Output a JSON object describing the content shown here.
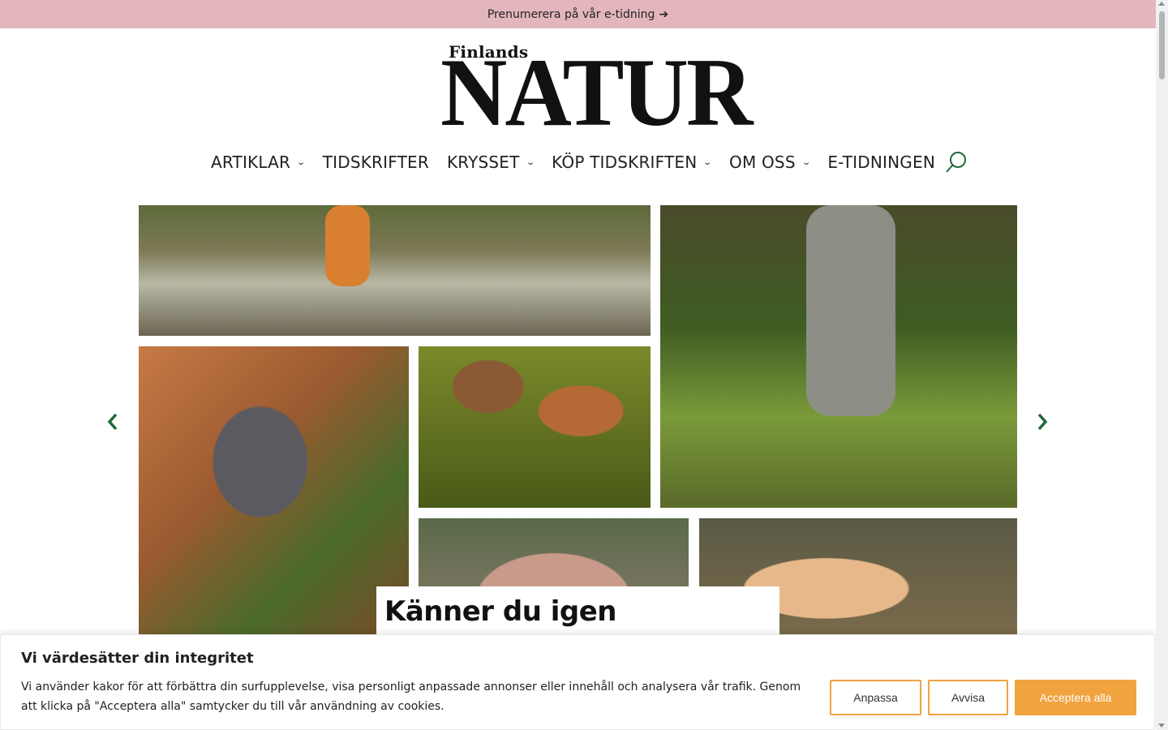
{
  "topbar": {
    "text": "Prenumerera på vår e-tidning",
    "arrow": "➔"
  },
  "logo": {
    "small": "Finlands",
    "big": "NATUR"
  },
  "nav": {
    "items": [
      {
        "label": "ARTIKLAR",
        "has_dropdown": true
      },
      {
        "label": "TIDSKRIFTER",
        "has_dropdown": false
      },
      {
        "label": "KRYSSET",
        "has_dropdown": true
      },
      {
        "label": "KÖP TIDSKRIFTEN",
        "has_dropdown": true
      },
      {
        "label": "OM OSS",
        "has_dropdown": true
      },
      {
        "label": "E-TIDNINGEN",
        "has_dropdown": false
      }
    ],
    "chevron": "⌄",
    "search_icon": "search-icon",
    "accent_color": "#1e6b3a"
  },
  "slider": {
    "title": "Känner du igen svamparna?",
    "prev_icon": "chevron-left-icon",
    "next_icon": "chevron-right-icon"
  },
  "cookie": {
    "title": "Vi värdesätter din integritet",
    "text": "Vi använder kakor för att förbättra din surfupplevelse, visa personligt anpassade annonser eller innehåll och analysera vår trafik. Genom att klicka på \"Acceptera alla\" samtycker du till vår användning av cookies.",
    "btn_customize": "Anpassa",
    "btn_reject": "Avvisa",
    "btn_accept": "Acceptera alla",
    "accent_color": "#f0a33f"
  }
}
